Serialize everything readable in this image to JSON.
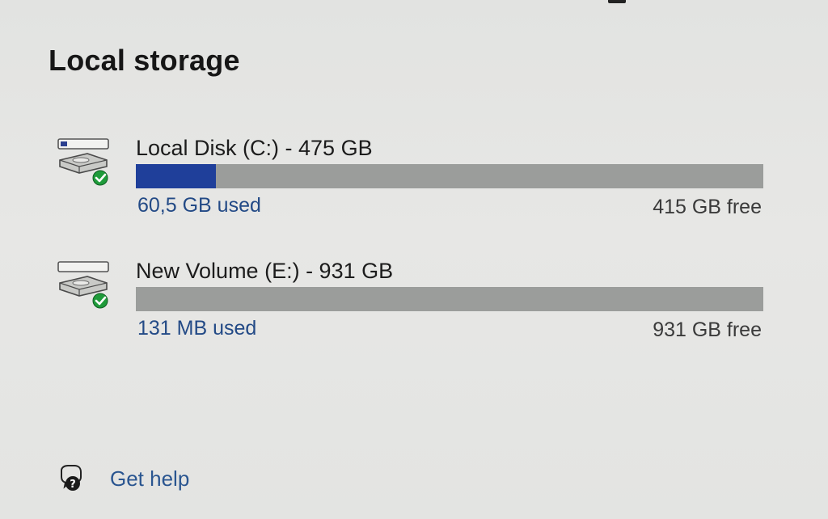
{
  "header": {
    "title": "Local storage"
  },
  "drives": [
    {
      "name": "Local Disk (C:) - 475 GB",
      "used": "60,5 GB used",
      "free": "415 GB free",
      "used_fraction": 0.127
    },
    {
      "name": "New Volume (E:) - 931 GB",
      "used": "131 MB used",
      "free": "931 GB free",
      "used_fraction": 0.0001
    }
  ],
  "help": {
    "label": "Get help",
    "icon": "help-icon"
  },
  "colors": {
    "accent": "#1f3f9a",
    "bar_track": "#9b9d9b",
    "link": "#2a5590",
    "status_ok": "#1f9b3a"
  }
}
